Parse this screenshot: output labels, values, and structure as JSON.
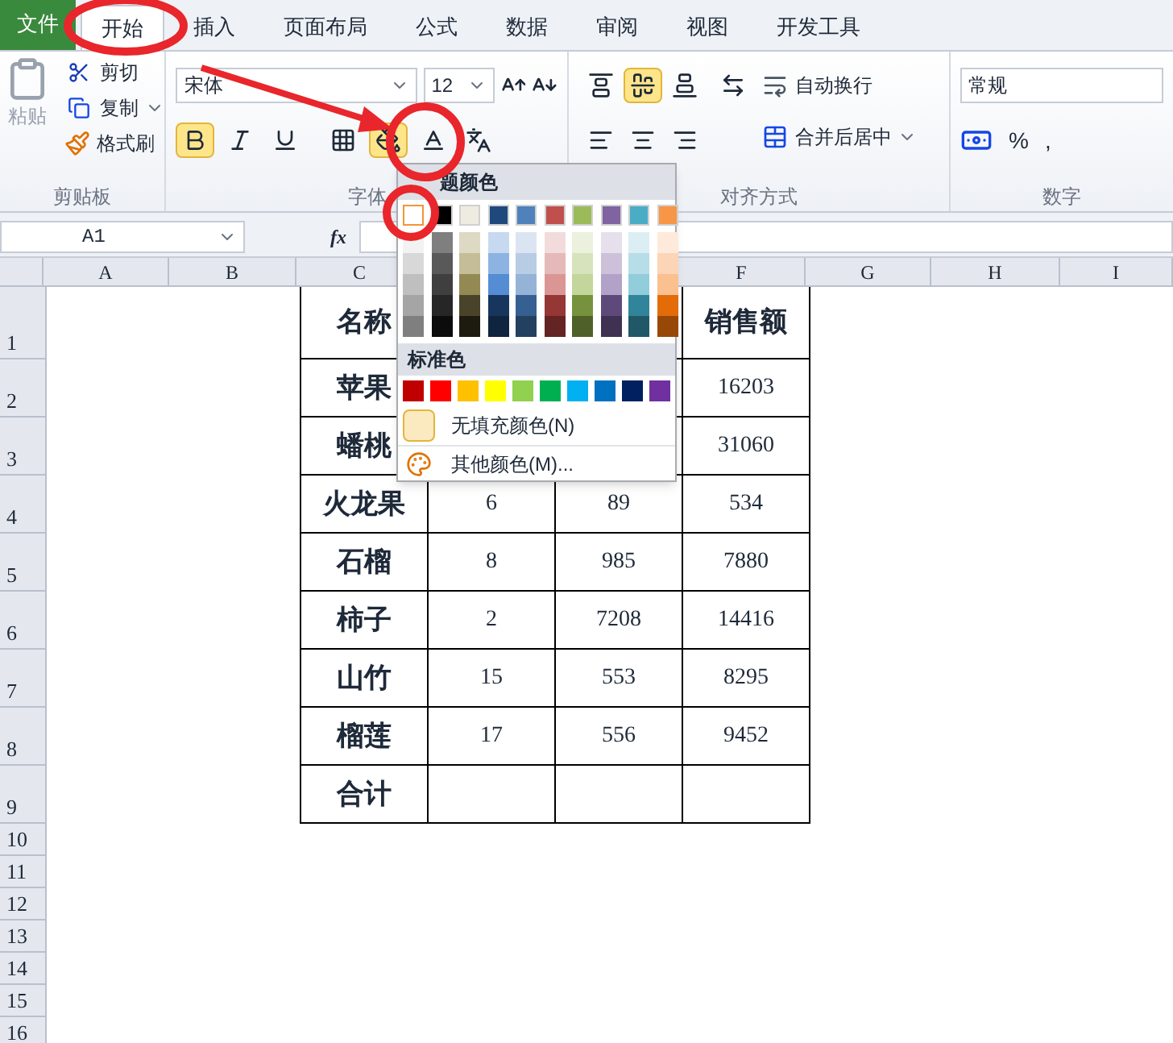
{
  "tabs": [
    {
      "label": "文件",
      "kind": "file",
      "selected": false
    },
    {
      "label": "开始",
      "kind": "tab",
      "selected": true
    },
    {
      "label": "插入",
      "kind": "tab",
      "selected": false
    },
    {
      "label": "页面布局",
      "kind": "tab",
      "selected": false
    },
    {
      "label": "公式",
      "kind": "tab",
      "selected": false
    },
    {
      "label": "数据",
      "kind": "tab",
      "selected": false
    },
    {
      "label": "审阅",
      "kind": "tab",
      "selected": false
    },
    {
      "label": "视图",
      "kind": "tab",
      "selected": false
    },
    {
      "label": "开发工具",
      "kind": "tab",
      "selected": false
    }
  ],
  "clipboard": {
    "paste": "粘贴",
    "cut": "剪切",
    "copy": "复制",
    "format_painter": "格式刷",
    "label": "剪贴板"
  },
  "font": {
    "font_name": "宋体",
    "font_size": "12",
    "label": "字体",
    "buttons": [
      {
        "kind": "bold",
        "on": true
      },
      {
        "kind": "italic",
        "on": false
      },
      {
        "kind": "underline",
        "on": false
      },
      {
        "kind": "borders",
        "on": false
      },
      {
        "kind": "fill",
        "on": true
      },
      {
        "kind": "font-color",
        "on": false
      },
      {
        "kind": "phonetic",
        "on": false
      }
    ]
  },
  "alignment": {
    "label": "对齐方式",
    "wrap": "自动换行",
    "merge": "合并后居中",
    "vertical": [
      {
        "kind": "top",
        "on": false
      },
      {
        "kind": "middle",
        "on": true
      },
      {
        "kind": "bottom",
        "on": false
      }
    ],
    "horizontal": [
      {
        "kind": "left",
        "on": false
      },
      {
        "kind": "center",
        "on": false
      },
      {
        "kind": "right",
        "on": false
      }
    ]
  },
  "number": {
    "label": "数字",
    "format": "常规",
    "symbols": [
      "%",
      ","
    ]
  },
  "formula_bar": {
    "name_box": "A1",
    "fx": "fx"
  },
  "columns_left": [
    "A",
    "B",
    "C"
  ],
  "columns_right": [
    "F",
    "G",
    "H",
    "I"
  ],
  "rows": [
    "1",
    "2",
    "3",
    "4",
    "5",
    "6",
    "7",
    "8",
    "9",
    "10",
    "11",
    "12",
    "13",
    "14",
    "15",
    "16"
  ],
  "table": [
    {
      "column_1": "名称",
      "column_4": "销售额"
    },
    {
      "column_1": "苹果",
      "column_4": "16203"
    },
    {
      "column_1": "蟠桃",
      "column_4": "31060"
    },
    {
      "column_1": "火龙果",
      "column_2": "6",
      "column_3": "89",
      "column_4": "534"
    },
    {
      "column_1": "石榴",
      "column_2": "8",
      "column_3": "985",
      "column_4": "7880"
    },
    {
      "column_1": "柿子",
      "column_2": "2",
      "column_3": "7208",
      "column_4": "14416"
    },
    {
      "column_1": "山竹",
      "column_2": "15",
      "column_3": "553",
      "column_4": "8295"
    },
    {
      "column_1": "榴莲",
      "column_2": "17",
      "column_3": "556",
      "column_4": "9452"
    },
    {
      "column_1": "合计"
    }
  ],
  "color_menu": {
    "theme_title": "题颜色",
    "standard_title": "标准色",
    "no_fill": "无填充颜色(N)",
    "more": "其他颜色(M)...",
    "theme_colors": [
      {
        "color": "#ffffff",
        "selected": true,
        "shades": [
          {
            "color": "#f2f2f2"
          },
          {
            "color": "#d8d8d8"
          },
          {
            "color": "#bfbfbf"
          },
          {
            "color": "#a5a5a5"
          },
          {
            "color": "#7f7f7f"
          }
        ]
      },
      {
        "color": "#000000",
        "selected": false,
        "shades": [
          {
            "color": "#7f7f7f"
          },
          {
            "color": "#595959"
          },
          {
            "color": "#3f3f3f"
          },
          {
            "color": "#262626"
          },
          {
            "color": "#0c0c0c"
          }
        ]
      },
      {
        "color": "#eeece1",
        "selected": false,
        "shades": [
          {
            "color": "#ddd9c3"
          },
          {
            "color": "#c4bd97"
          },
          {
            "color": "#938953"
          },
          {
            "color": "#494429"
          },
          {
            "color": "#1d1b10"
          }
        ]
      },
      {
        "color": "#1f497d",
        "selected": false,
        "shades": [
          {
            "color": "#c6d9f0"
          },
          {
            "color": "#8db3e2"
          },
          {
            "color": "#548dd4"
          },
          {
            "color": "#17365d"
          },
          {
            "color": "#0f243e"
          }
        ]
      },
      {
        "color": "#4f81bd",
        "selected": false,
        "shades": [
          {
            "color": "#dbe5f1"
          },
          {
            "color": "#b8cce4"
          },
          {
            "color": "#95b3d7"
          },
          {
            "color": "#366092"
          },
          {
            "color": "#244061"
          }
        ]
      },
      {
        "color": "#c0504d",
        "selected": false,
        "shades": [
          {
            "color": "#f2dcdb"
          },
          {
            "color": "#e5b9b7"
          },
          {
            "color": "#d99694"
          },
          {
            "color": "#953734"
          },
          {
            "color": "#632423"
          }
        ]
      },
      {
        "color": "#9bbb59",
        "selected": false,
        "shades": [
          {
            "color": "#ebf1dd"
          },
          {
            "color": "#d7e3bc"
          },
          {
            "color": "#c3d69b"
          },
          {
            "color": "#76923c"
          },
          {
            "color": "#4f6128"
          }
        ]
      },
      {
        "color": "#8064a2",
        "selected": false,
        "shades": [
          {
            "color": "#e5e0ec"
          },
          {
            "color": "#ccc1d9"
          },
          {
            "color": "#b2a2c7"
          },
          {
            "color": "#5f497a"
          },
          {
            "color": "#3f3151"
          }
        ]
      },
      {
        "color": "#4bacc6",
        "selected": false,
        "shades": [
          {
            "color": "#dbeef3"
          },
          {
            "color": "#b7dde8"
          },
          {
            "color": "#92cddc"
          },
          {
            "color": "#31859b"
          },
          {
            "color": "#205867"
          }
        ]
      },
      {
        "color": "#f79646",
        "selected": false,
        "shades": [
          {
            "color": "#fdeada"
          },
          {
            "color": "#fbd5b5"
          },
          {
            "color": "#fac08f"
          },
          {
            "color": "#e36c09"
          },
          {
            "color": "#974806"
          }
        ]
      }
    ],
    "standard_colors": [
      {
        "color": "#c00000"
      },
      {
        "color": "#ff0000"
      },
      {
        "color": "#ffc000"
      },
      {
        "color": "#ffff00"
      },
      {
        "color": "#92d050"
      },
      {
        "color": "#00b050"
      },
      {
        "color": "#00b0f0"
      },
      {
        "color": "#0070c0"
      },
      {
        "color": "#002060"
      },
      {
        "color": "#7030a0"
      }
    ]
  }
}
